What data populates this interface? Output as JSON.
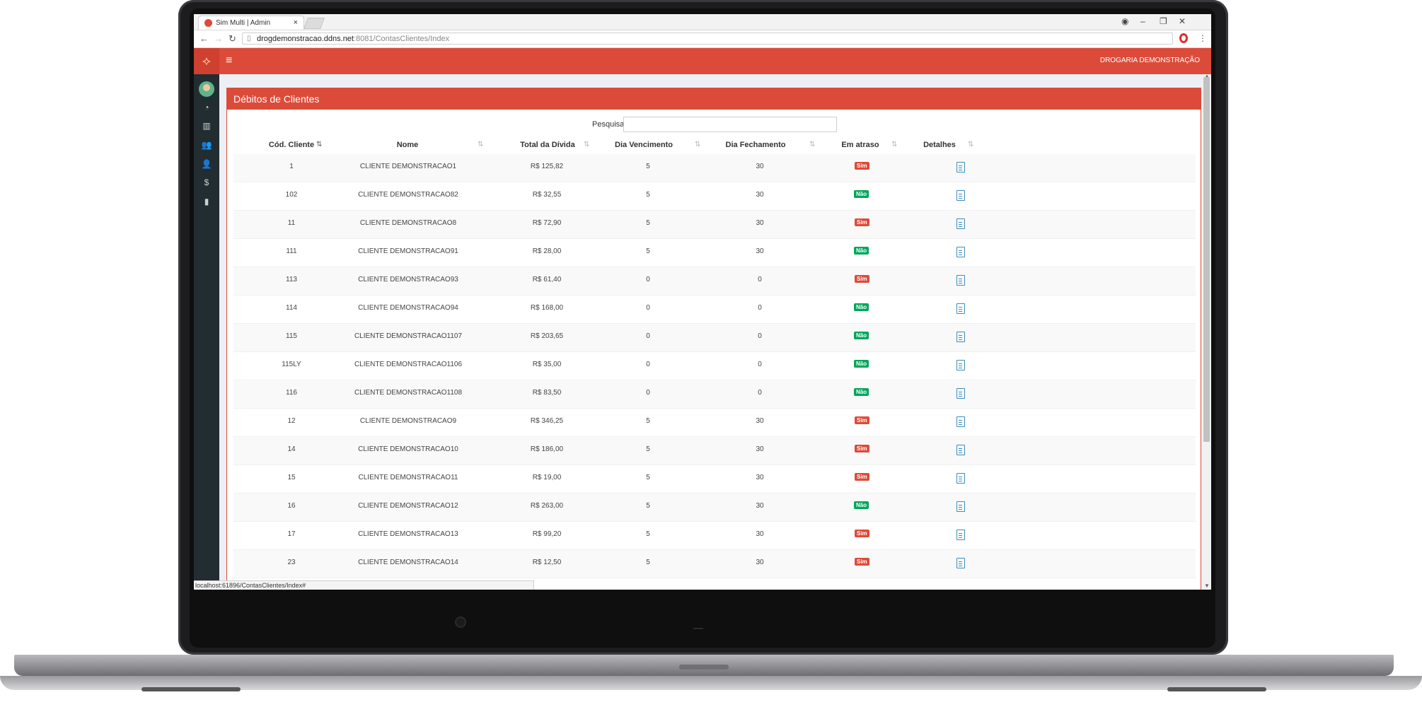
{
  "browser": {
    "tab_title": "Sim Multi | Admin",
    "tab_close": "×",
    "url_host": "drogdemonstracao.ddns.net",
    "url_path": ":8081/ContasClientes/Index",
    "status_url": "localhost:61896/ContasClientes/Index#"
  },
  "header": {
    "brand": "DROGARIA DEMONSTRAÇÃO",
    "menu_icon": "≡"
  },
  "sidebar": {
    "items": [
      "dashboard-icon",
      "barcode-icon",
      "users-icon",
      "user-icon",
      "dollar-icon",
      "bar-chart-icon"
    ],
    "glyphs": [
      "◔",
      "▥",
      "👥",
      "👤",
      "$",
      "▮"
    ]
  },
  "box": {
    "title": "Débitos de Clientes",
    "search_label": "Pesquisar",
    "search_value": ""
  },
  "table": {
    "columns": [
      "Cód. Cliente",
      "Nome",
      "Total da Dívida",
      "Dia Vencimento",
      "Dia Fechamento",
      "Em atraso",
      "Detalhes"
    ],
    "rows": [
      {
        "cod": "1",
        "nome": "CLIENTE DEMONSTRACAO1",
        "total": "R$ 125,82",
        "venc": "5",
        "fech": "30",
        "atraso": "Sim"
      },
      {
        "cod": "102",
        "nome": "CLIENTE DEMONSTRACAO82",
        "total": "R$ 32,55",
        "venc": "5",
        "fech": "30",
        "atraso": "Não"
      },
      {
        "cod": "11",
        "nome": "CLIENTE DEMONSTRACAO8",
        "total": "R$ 72,90",
        "venc": "5",
        "fech": "30",
        "atraso": "Sim"
      },
      {
        "cod": "111",
        "nome": "CLIENTE DEMONSTRACAO91",
        "total": "R$ 28,00",
        "venc": "5",
        "fech": "30",
        "atraso": "Não"
      },
      {
        "cod": "113",
        "nome": "CLIENTE DEMONSTRACAO93",
        "total": "R$ 61,40",
        "venc": "0",
        "fech": "0",
        "atraso": "Sim"
      },
      {
        "cod": "114",
        "nome": "CLIENTE DEMONSTRACAO94",
        "total": "R$ 168,00",
        "venc": "0",
        "fech": "0",
        "atraso": "Não"
      },
      {
        "cod": "115",
        "nome": "CLIENTE DEMONSTRACAO1107",
        "total": "R$ 203,65",
        "venc": "0",
        "fech": "0",
        "atraso": "Não"
      },
      {
        "cod": "115LY",
        "nome": "CLIENTE DEMONSTRACAO1106",
        "total": "R$ 35,00",
        "venc": "0",
        "fech": "0",
        "atraso": "Não"
      },
      {
        "cod": "116",
        "nome": "CLIENTE DEMONSTRACAO1108",
        "total": "R$ 83,50",
        "venc": "0",
        "fech": "0",
        "atraso": "Não"
      },
      {
        "cod": "12",
        "nome": "CLIENTE DEMONSTRACAO9",
        "total": "R$ 346,25",
        "venc": "5",
        "fech": "30",
        "atraso": "Sim"
      },
      {
        "cod": "14",
        "nome": "CLIENTE DEMONSTRACAO10",
        "total": "R$ 186,00",
        "venc": "5",
        "fech": "30",
        "atraso": "Sim"
      },
      {
        "cod": "15",
        "nome": "CLIENTE DEMONSTRACAO11",
        "total": "R$ 19,00",
        "venc": "5",
        "fech": "30",
        "atraso": "Sim"
      },
      {
        "cod": "16",
        "nome": "CLIENTE DEMONSTRACAO12",
        "total": "R$ 263,00",
        "venc": "5",
        "fech": "30",
        "atraso": "Não"
      },
      {
        "cod": "17",
        "nome": "CLIENTE DEMONSTRACAO13",
        "total": "R$ 99,20",
        "venc": "5",
        "fech": "30",
        "atraso": "Sim"
      },
      {
        "cod": "23",
        "nome": "CLIENTE DEMONSTRACAO14",
        "total": "R$ 12,50",
        "venc": "5",
        "fech": "30",
        "atraso": "Sim"
      }
    ]
  },
  "colors": {
    "accent": "#dc4b3a",
    "sidebar_bg": "#222d32",
    "badge_sim": "#dd4b39",
    "badge_nao": "#00a65a"
  }
}
